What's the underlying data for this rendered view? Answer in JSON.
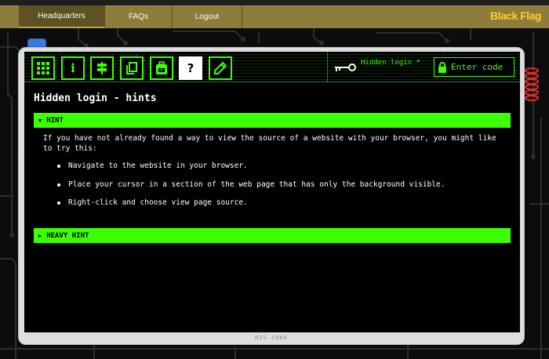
{
  "nav": {
    "items": [
      {
        "label": "Headquarters",
        "active": true
      },
      {
        "label": "FAQs",
        "active": false
      },
      {
        "label": "Logout",
        "active": false
      }
    ],
    "brand": "Black Flag"
  },
  "toolbar": {
    "buttons": [
      {
        "icon": "grid-icon"
      },
      {
        "icon": "info-icon",
        "label": "i"
      },
      {
        "icon": "signpost-icon"
      },
      {
        "icon": "copy-icon"
      },
      {
        "icon": "backpack-icon"
      },
      {
        "icon": "help-icon",
        "label": "?",
        "active": true
      },
      {
        "icon": "pencil-icon"
      }
    ],
    "hidden_login": "Hidden login *",
    "enter_code": "Enter code"
  },
  "content": {
    "title": "Hidden login - hints",
    "hint": {
      "label": "HINT",
      "expanded": true,
      "intro": "If you have not already found a way to view the source of a website with your browser, you might like to try this:",
      "steps": [
        "Navigate to the website in your browser.",
        "Place your cursor in a section of the web page that has only the background visible.",
        "Right-click and choose view page source."
      ]
    },
    "heavy_hint": {
      "label": "HEAVY HINT",
      "expanded": false
    }
  },
  "device": {
    "label": "RIG-2000"
  },
  "colors": {
    "accent": "#3cff00",
    "nav_bar": "#8e7c3a",
    "brand": "#ffcc33",
    "led": "#3a7be0"
  }
}
